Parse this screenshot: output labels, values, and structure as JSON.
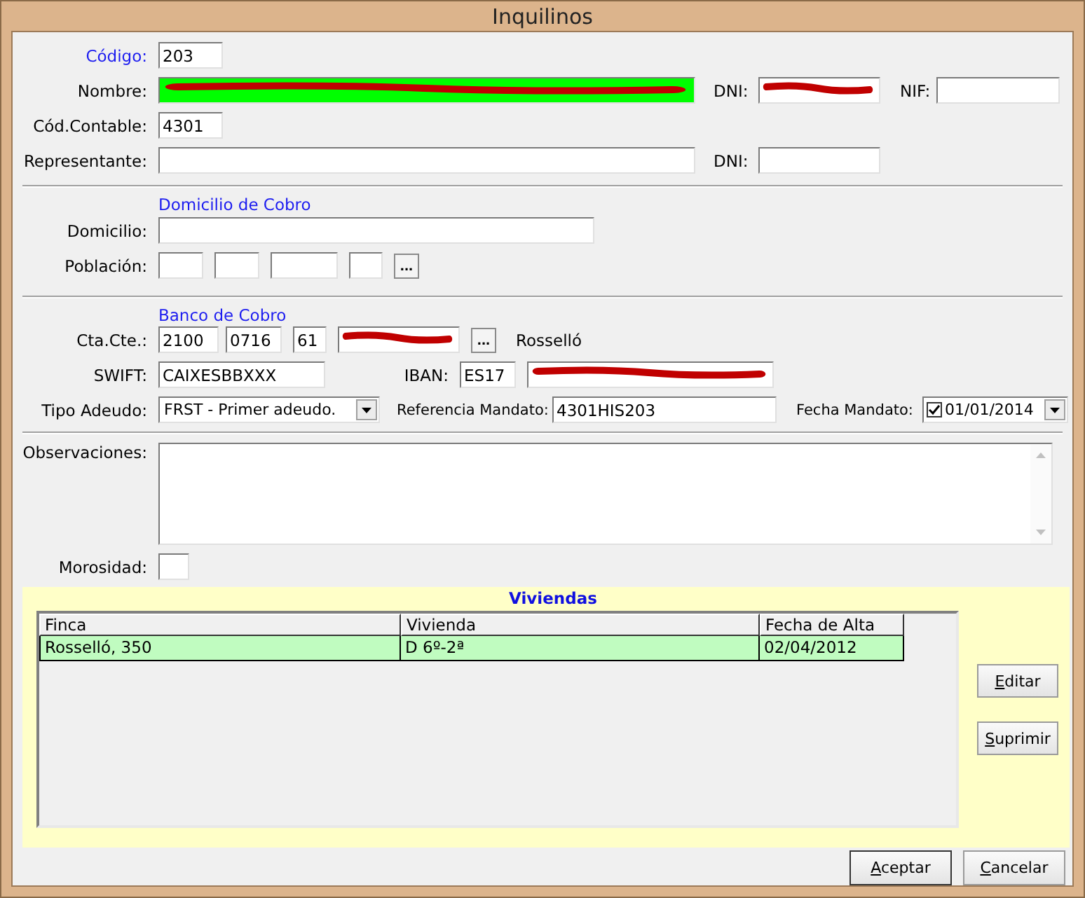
{
  "window": {
    "title": "Inquilinos"
  },
  "codigo": {
    "label": "Código:",
    "value": "203"
  },
  "nombre": {
    "label": "Nombre:",
    "redacted": true,
    "highlighted": true
  },
  "dni": {
    "label": "DNI:",
    "redacted": true
  },
  "nif": {
    "label": "NIF:"
  },
  "cod_contable": {
    "label": "Cód.Contable:",
    "value": "4301"
  },
  "representante": {
    "label": "Representante:"
  },
  "representante_dni": {
    "label": "DNI:"
  },
  "domicilio_section": {
    "title": "Domicilio de Cobro"
  },
  "domicilio": {
    "label": "Domicilio:"
  },
  "poblacion": {
    "label": "Población:",
    "button": "..."
  },
  "banco_section": {
    "title": "Banco de Cobro"
  },
  "cta_cte": {
    "label": "Cta.Cte.:",
    "parts": [
      {
        "value": "2100",
        "redacted": false
      },
      {
        "value": "0716",
        "redacted": false
      },
      {
        "value": "61",
        "redacted": false
      },
      {
        "redacted": true
      }
    ],
    "button": "...",
    "bank_name": "Rosselló"
  },
  "swift": {
    "label": "SWIFT:",
    "value": "CAIXESBBXXX"
  },
  "iban": {
    "label": "IBAN:",
    "country": "ES17",
    "redacted": true
  },
  "tipo_adeudo": {
    "label": "Tipo Adeudo:",
    "value": "FRST - Primer adeudo."
  },
  "referencia_mandato": {
    "label": "Referencia Mandato:",
    "value": "4301HIS203"
  },
  "fecha_mandato": {
    "label": "Fecha Mandato:",
    "checked": true,
    "value": "01/01/2014"
  },
  "observaciones": {
    "label": "Observaciones:"
  },
  "morosidad": {
    "label": "Morosidad:"
  },
  "viviendas": {
    "title": "Viviendas",
    "columns": [
      "Finca",
      "Vivienda",
      "Fecha de Alta"
    ],
    "rows": [
      {
        "cells": [
          "Rosselló, 350",
          "D 6º-2ª",
          "02/04/2012"
        ],
        "selected": true
      }
    ],
    "buttons": [
      "Editar",
      "Suprimir"
    ]
  },
  "buttons": [
    "Aceptar",
    "Cancelar"
  ]
}
